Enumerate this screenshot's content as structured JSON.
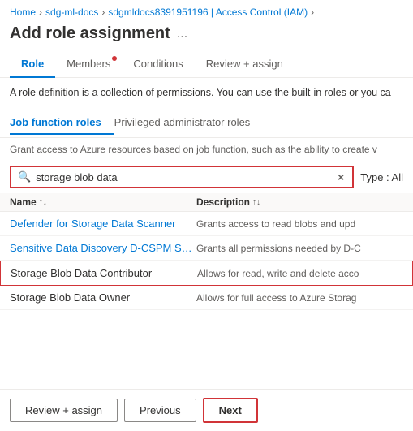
{
  "breadcrumb": {
    "items": [
      {
        "label": "Home",
        "separator": true
      },
      {
        "label": "sdg-ml-docs",
        "separator": true
      },
      {
        "label": "sdgmldocs8391951196 | Access Control (IAM)",
        "separator": true
      }
    ]
  },
  "page": {
    "title": "Add role assignment",
    "dots": "..."
  },
  "tabs": [
    {
      "label": "Role",
      "id": "role",
      "active": true,
      "dot": false
    },
    {
      "label": "Members",
      "id": "members",
      "active": false,
      "dot": true
    },
    {
      "label": "Conditions",
      "id": "conditions",
      "active": false,
      "dot": false
    },
    {
      "label": "Review + assign",
      "id": "review",
      "active": false,
      "dot": false
    }
  ],
  "description": "A role definition is a collection of permissions. You can use the built-in roles or you ca",
  "role_type_tabs": [
    {
      "label": "Job function roles",
      "active": true
    },
    {
      "label": "Privileged administrator roles",
      "active": false
    }
  ],
  "grant_text": "Grant access to Azure resources based on job function, such as the ability to create v",
  "search": {
    "value": "storage blob data",
    "placeholder": "Search by role name or description"
  },
  "type_filter": "Type : All",
  "table": {
    "headers": [
      {
        "label": "Name",
        "sort": "↑↓"
      },
      {
        "label": "Description",
        "sort": "↑↓"
      }
    ],
    "rows": [
      {
        "name": "Defender for Storage Data Scanner",
        "description": "Grants access to read blobs and upd",
        "selected": false,
        "link": true
      },
      {
        "name": "Sensitive Data Discovery D-CSPM Scanner O...",
        "description": "Grants all permissions needed by D-C",
        "selected": false,
        "link": true
      },
      {
        "name": "Storage Blob Data Contributor",
        "description": "Allows for read, write and delete acco",
        "selected": true,
        "link": false
      },
      {
        "name": "Storage Blob Data Owner",
        "description": "Allows for full access to Azure Storag",
        "selected": false,
        "link": false
      }
    ]
  },
  "footer": {
    "review_assign": "Review + assign",
    "previous": "Previous",
    "next": "Next"
  }
}
